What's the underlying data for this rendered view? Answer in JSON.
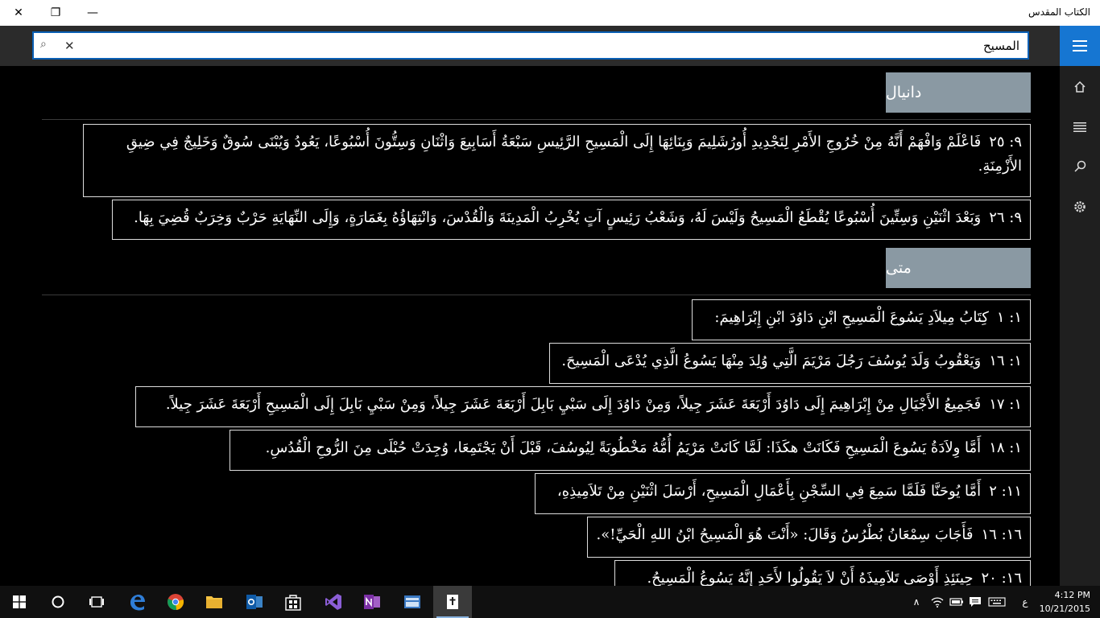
{
  "window": {
    "title": "الكتاب المقدس",
    "close_glyph": "✕",
    "restore_glyph": "❐",
    "minimize_glyph": "—"
  },
  "search": {
    "value": "المسيح",
    "clear_glyph": "✕",
    "search_glyph": "⌕"
  },
  "nav_icons": [
    "hamburger-icon",
    "home-icon",
    "list-icon",
    "search-icon",
    "gear-icon"
  ],
  "results": [
    {
      "book": "دانيال",
      "verses": [
        {
          "ref": "٩: ٢٥",
          "text": "فَاعْلَمْ وَافْهَمْ أَنَّهُ مِنْ خُرُوجِ الأَمْرِ لِتَجْدِيدِ أُورُشَلِيمَ وَبِنَائِهَا إِلَى الْمَسِيحِ الرَّئِيسِ سَبْعَةُ أَسَابِيعَ وَاثْنَانِ وَسِتُّونَ أُسْبُوعًا، يَعُودُ وَيُبْنَى سُوقٌ وَخَلِيجٌ فِي ضِيقِ الأَزْمِنَةِ."
        },
        {
          "ref": "٩: ٢٦",
          "text": "وَبَعْدَ اثْنَيْنِ وَسِتِّينَ أُسْبُوعًا يُقْطَعُ الْمَسِيحُ وَلَيْسَ لَهُ، وَشَعْبُ رَئِيسٍ آتٍ يُخْرِبُ الْمَدِينَةَ وَالْقُدْسَ، وَانْتِهَاؤُهُ بِغَمَارَةٍ، وَإِلَى النِّهَايَةِ حَرْبٌ وَخِرَبٌ قُضِيَ بِهَا."
        }
      ]
    },
    {
      "book": "متى",
      "verses": [
        {
          "ref": "١: ١",
          "text": "كِتَابُ مِيلاَدِ يَسُوعَ الْمَسِيحِ ابْنِ دَاوُدَ ابْنِ إِبْرَاهِيمَ:"
        },
        {
          "ref": "١: ١٦",
          "text": "وَيَعْقُوبُ وَلَدَ يُوسُفَ رَجُلَ مَرْيَمَ الَّتِي وُلِدَ مِنْهَا يَسُوعُ الَّذِي يُدْعَى الْمَسِيحَ."
        },
        {
          "ref": "١: ١٧",
          "text": "فَجَمِيعُ الأَجْيَالِ مِنْ إِبْرَاهِيمَ إِلَى دَاوُدَ أَرْبَعَةَ عَشَرَ جِيلاً، وَمِنْ دَاوُدَ إِلَى سَبْيِ بَابِلَ أَرْبَعَةَ عَشَرَ جِيلاً، وَمِنْ سَبْيِ بَابِلَ إِلَى الْمَسِيحِ أَرْبَعَةَ عَشَرَ جِيلاً."
        },
        {
          "ref": "١: ١٨",
          "text": "أَمَّا وِلاَدَةُ يَسُوعَ الْمَسِيحِ فَكَانَتْ هكَذَا: لَمَّا كَانَتْ مَرْيَمُ أُمُّهُ مَخْطُوبَةً لِيُوسُفَ، قَبْلَ أَنْ يَجْتَمِعَا، وُجِدَتْ حُبْلَى مِنَ الرُّوحِ الْقُدُسِ."
        },
        {
          "ref": "١١: ٢",
          "text": "أَمَّا يُوحَنَّا فَلَمَّا سَمِعَ فِي السِّجْنِ بِأَعْمَالِ الْمَسِيحِ، أَرْسَلَ اثْنَيْنِ مِنْ تَلاَمِيذِهِ،"
        },
        {
          "ref": "١٦: ١٦",
          "text": "فَأَجَابَ سِمْعَانُ بُطْرُسُ وَقَالَ: «أَنْتَ هُوَ الْمَسِيحُ ابْنُ اللهِ الْحَيِّ!»."
        },
        {
          "ref": "١٦: ٢٠",
          "text": "حِينَئِذٍ أَوْصَى تَلاَمِيذَهُ أَنْ لاَ يَقُولُوا لأَحَدٍ إِنَّهُ يَسُوعُ الْمَسِيحُ."
        }
      ]
    }
  ],
  "taskbar": {
    "apps": [
      "windows-start-icon",
      "cortana-icon",
      "task-view-icon",
      "edge-icon",
      "chrome-icon",
      "file-explorer-icon",
      "outlook-icon",
      "store-icon",
      "visual-studio-icon",
      "onenote-icon",
      "app-icon",
      "bible-app-icon"
    ],
    "tray_chevron": "∧",
    "language": "ع",
    "time": "4:12 PM",
    "date": "10/21/2015"
  }
}
